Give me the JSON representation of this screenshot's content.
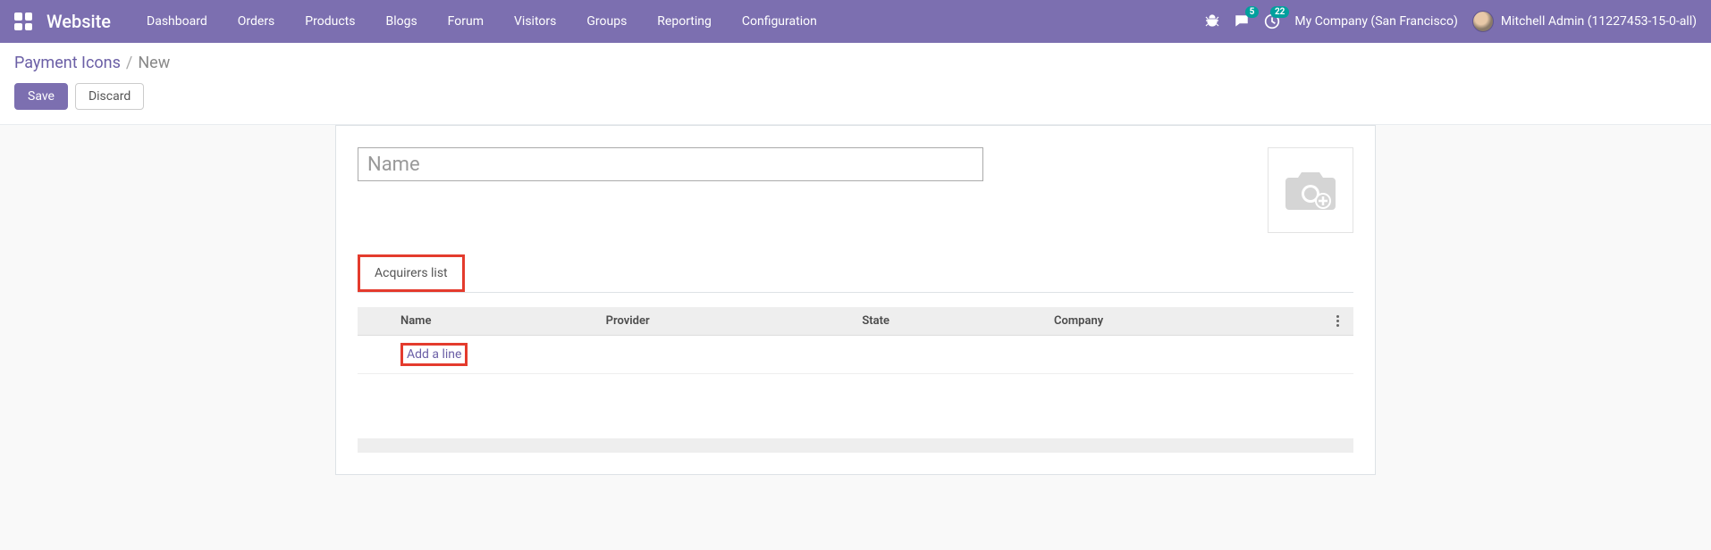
{
  "navbar": {
    "brand": "Website",
    "links": [
      "Dashboard",
      "Orders",
      "Products",
      "Blogs",
      "Forum",
      "Visitors",
      "Groups",
      "Reporting",
      "Configuration"
    ],
    "messages_badge": "5",
    "activities_badge": "22",
    "company": "My Company (San Francisco)",
    "user": "Mitchell Admin (11227453-15-0-all)"
  },
  "breadcrumb": {
    "root": "Payment Icons",
    "current": "New"
  },
  "buttons": {
    "save": "Save",
    "discard": "Discard"
  },
  "form": {
    "name_placeholder": "Name",
    "tab_label": "Acquirers list",
    "columns": {
      "name": "Name",
      "provider": "Provider",
      "state": "State",
      "company": "Company"
    },
    "add_line": "Add a line"
  }
}
